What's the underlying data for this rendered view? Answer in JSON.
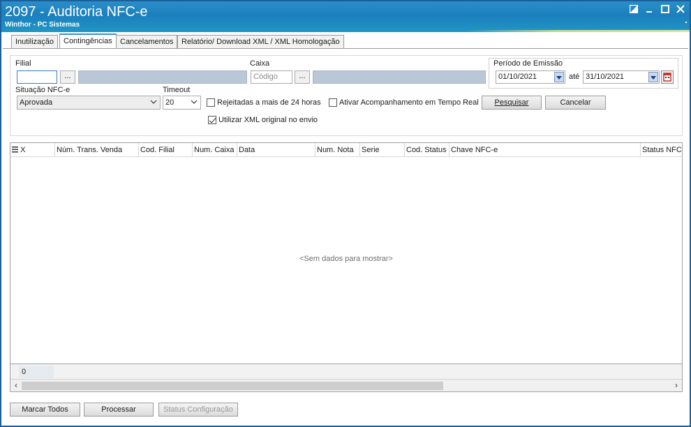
{
  "window": {
    "title": "2097 - Auditoria NFC-e",
    "subtitle": "Winthor - PC Sistemas"
  },
  "window_controls": {
    "restore_icon": "restore-icon",
    "minimize": "–",
    "maximize": "☐",
    "close": "✕"
  },
  "tabs": [
    {
      "label": "Inutilização",
      "active": false
    },
    {
      "label": "Contingências",
      "active": true
    },
    {
      "label": "Cancelamentos",
      "active": false
    },
    {
      "label": "Relatório/ Download XML / XML Homologação",
      "active": false
    }
  ],
  "filters": {
    "filial": {
      "label": "Filial",
      "value": "",
      "button": "..."
    },
    "caixa": {
      "label": "Caixa",
      "placeholder": "Código",
      "button": "..."
    },
    "periodo": {
      "label": "Período de Emissão",
      "start": "01/10/2021",
      "sep": "até",
      "end": "31/10/2021"
    },
    "situacao": {
      "label": "Situação NFC-e",
      "value": "Aprovada"
    },
    "timeout": {
      "label": "Timeout",
      "value": "20"
    },
    "rejeitadas": {
      "label": "Rejeitadas a mais de 24 horas",
      "checked": false
    },
    "acompanhamento": {
      "label": "Ativar Acompanhamento em Tempo Real",
      "checked": false
    },
    "utilizar_xml": {
      "label": "Utilizar XML original no envio",
      "checked": true
    },
    "pesquisar": "Pesquisar",
    "cancelar": "Cancelar"
  },
  "grid": {
    "columns": [
      "X",
      "Núm. Trans. Venda",
      "Cod. Filial",
      "Num. Caixa",
      "Data",
      "Num. Nota",
      "Serie",
      "Cod. Status",
      "Chave NFC-e",
      "Status NFC-e"
    ],
    "empty_text": "<Sem dados para mostrar>",
    "footer_count": "0"
  },
  "actions": {
    "marcar_todos": "Marcar Todos",
    "processar": "Processar",
    "status_config": "Status Configuração"
  },
  "colors": {
    "titlebar": "#1b7fbd",
    "grey_field": "#b9c7d6"
  }
}
